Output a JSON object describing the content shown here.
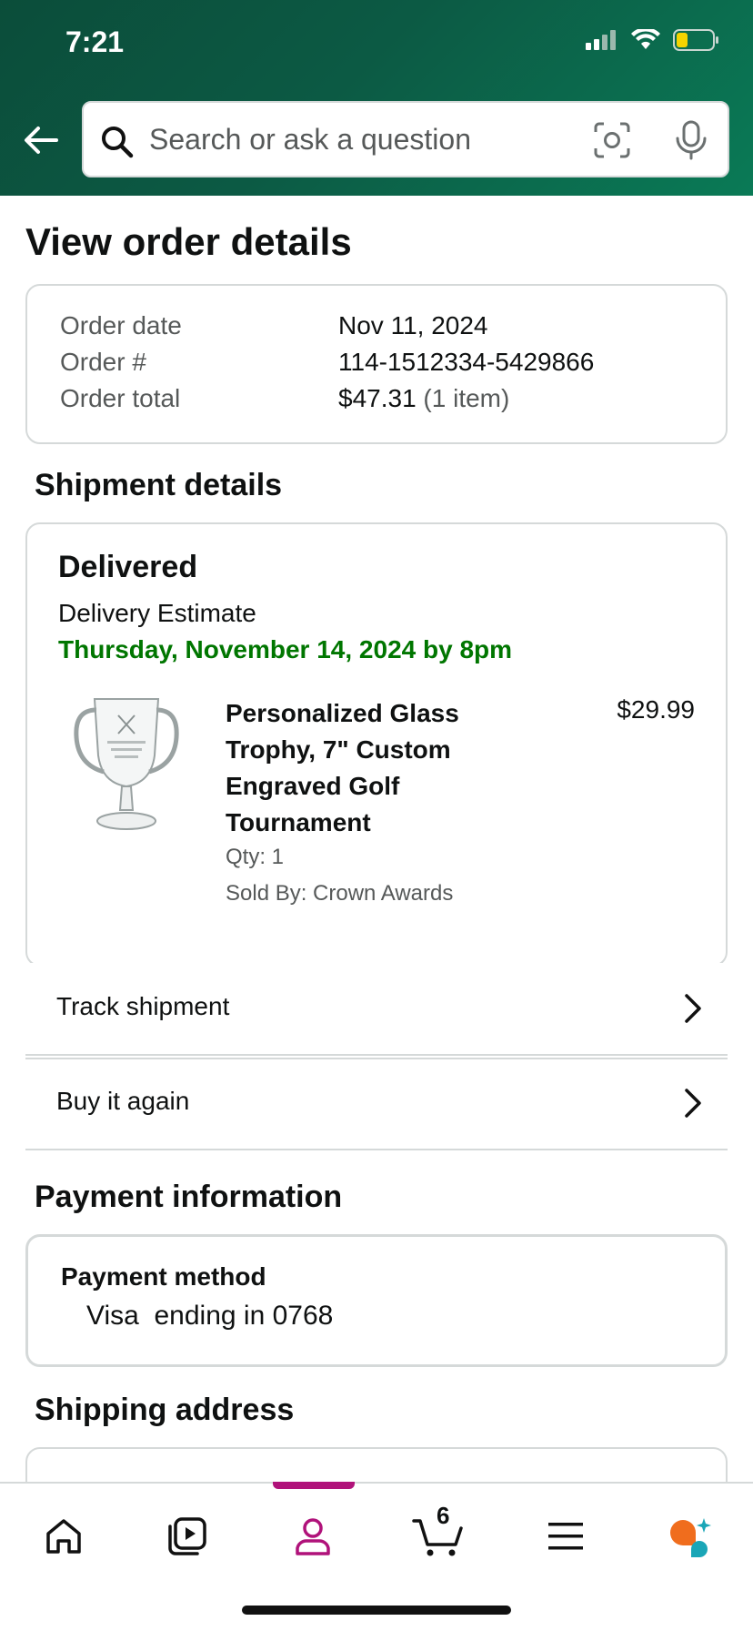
{
  "status_bar": {
    "time": "7:21"
  },
  "search": {
    "placeholder": "Search or ask a question"
  },
  "page": {
    "title": "View order details"
  },
  "order_summary": {
    "rows": [
      {
        "label": "Order date",
        "value": "Nov 11, 2024"
      },
      {
        "label": "Order #",
        "value": "114-1512334-5429866"
      },
      {
        "label": "Order total",
        "value": "$47.31",
        "extra": "(1 item)"
      }
    ]
  },
  "shipment": {
    "section_title": "Shipment details",
    "status": "Delivered",
    "estimate_label": "Delivery Estimate",
    "estimate_date": "Thursday, November 14, 2024 by 8pm",
    "product": {
      "title": "Personalized Glass Trophy, 7\" Custom Engraved Golf Tournament",
      "price": "$29.99",
      "qty": "Qty: 1",
      "sold_by": "Sold By: Crown Awards"
    }
  },
  "actions": [
    {
      "label": "Track shipment"
    },
    {
      "label": "Buy it again"
    }
  ],
  "payment": {
    "section_title": "Payment information",
    "method_label": "Payment method",
    "method_value": "Visa  ending in 0768"
  },
  "shipping": {
    "section_title": "Shipping address"
  },
  "bottom_nav": {
    "items": [
      "home-icon",
      "video-icon",
      "account-icon",
      "cart-icon",
      "menu-icon",
      "rufus-icon"
    ],
    "cart_count": "6",
    "active_color": "#b0127a"
  },
  "colors": {
    "accent_green": "#007600",
    "header_green": "#0b5a43"
  }
}
